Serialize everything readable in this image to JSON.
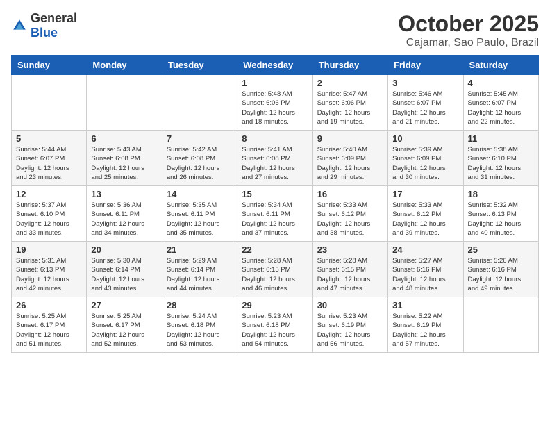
{
  "logo": {
    "general": "General",
    "blue": "Blue"
  },
  "title": "October 2025",
  "location": "Cajamar, Sao Paulo, Brazil",
  "days_header": [
    "Sunday",
    "Monday",
    "Tuesday",
    "Wednesday",
    "Thursday",
    "Friday",
    "Saturday"
  ],
  "weeks": [
    [
      {
        "day": "",
        "info": ""
      },
      {
        "day": "",
        "info": ""
      },
      {
        "day": "",
        "info": ""
      },
      {
        "day": "1",
        "info": "Sunrise: 5:48 AM\nSunset: 6:06 PM\nDaylight: 12 hours\nand 18 minutes."
      },
      {
        "day": "2",
        "info": "Sunrise: 5:47 AM\nSunset: 6:06 PM\nDaylight: 12 hours\nand 19 minutes."
      },
      {
        "day": "3",
        "info": "Sunrise: 5:46 AM\nSunset: 6:07 PM\nDaylight: 12 hours\nand 21 minutes."
      },
      {
        "day": "4",
        "info": "Sunrise: 5:45 AM\nSunset: 6:07 PM\nDaylight: 12 hours\nand 22 minutes."
      }
    ],
    [
      {
        "day": "5",
        "info": "Sunrise: 5:44 AM\nSunset: 6:07 PM\nDaylight: 12 hours\nand 23 minutes."
      },
      {
        "day": "6",
        "info": "Sunrise: 5:43 AM\nSunset: 6:08 PM\nDaylight: 12 hours\nand 25 minutes."
      },
      {
        "day": "7",
        "info": "Sunrise: 5:42 AM\nSunset: 6:08 PM\nDaylight: 12 hours\nand 26 minutes."
      },
      {
        "day": "8",
        "info": "Sunrise: 5:41 AM\nSunset: 6:08 PM\nDaylight: 12 hours\nand 27 minutes."
      },
      {
        "day": "9",
        "info": "Sunrise: 5:40 AM\nSunset: 6:09 PM\nDaylight: 12 hours\nand 29 minutes."
      },
      {
        "day": "10",
        "info": "Sunrise: 5:39 AM\nSunset: 6:09 PM\nDaylight: 12 hours\nand 30 minutes."
      },
      {
        "day": "11",
        "info": "Sunrise: 5:38 AM\nSunset: 6:10 PM\nDaylight: 12 hours\nand 31 minutes."
      }
    ],
    [
      {
        "day": "12",
        "info": "Sunrise: 5:37 AM\nSunset: 6:10 PM\nDaylight: 12 hours\nand 33 minutes."
      },
      {
        "day": "13",
        "info": "Sunrise: 5:36 AM\nSunset: 6:11 PM\nDaylight: 12 hours\nand 34 minutes."
      },
      {
        "day": "14",
        "info": "Sunrise: 5:35 AM\nSunset: 6:11 PM\nDaylight: 12 hours\nand 35 minutes."
      },
      {
        "day": "15",
        "info": "Sunrise: 5:34 AM\nSunset: 6:11 PM\nDaylight: 12 hours\nand 37 minutes."
      },
      {
        "day": "16",
        "info": "Sunrise: 5:33 AM\nSunset: 6:12 PM\nDaylight: 12 hours\nand 38 minutes."
      },
      {
        "day": "17",
        "info": "Sunrise: 5:33 AM\nSunset: 6:12 PM\nDaylight: 12 hours\nand 39 minutes."
      },
      {
        "day": "18",
        "info": "Sunrise: 5:32 AM\nSunset: 6:13 PM\nDaylight: 12 hours\nand 40 minutes."
      }
    ],
    [
      {
        "day": "19",
        "info": "Sunrise: 5:31 AM\nSunset: 6:13 PM\nDaylight: 12 hours\nand 42 minutes."
      },
      {
        "day": "20",
        "info": "Sunrise: 5:30 AM\nSunset: 6:14 PM\nDaylight: 12 hours\nand 43 minutes."
      },
      {
        "day": "21",
        "info": "Sunrise: 5:29 AM\nSunset: 6:14 PM\nDaylight: 12 hours\nand 44 minutes."
      },
      {
        "day": "22",
        "info": "Sunrise: 5:28 AM\nSunset: 6:15 PM\nDaylight: 12 hours\nand 46 minutes."
      },
      {
        "day": "23",
        "info": "Sunrise: 5:28 AM\nSunset: 6:15 PM\nDaylight: 12 hours\nand 47 minutes."
      },
      {
        "day": "24",
        "info": "Sunrise: 5:27 AM\nSunset: 6:16 PM\nDaylight: 12 hours\nand 48 minutes."
      },
      {
        "day": "25",
        "info": "Sunrise: 5:26 AM\nSunset: 6:16 PM\nDaylight: 12 hours\nand 49 minutes."
      }
    ],
    [
      {
        "day": "26",
        "info": "Sunrise: 5:25 AM\nSunset: 6:17 PM\nDaylight: 12 hours\nand 51 minutes."
      },
      {
        "day": "27",
        "info": "Sunrise: 5:25 AM\nSunset: 6:17 PM\nDaylight: 12 hours\nand 52 minutes."
      },
      {
        "day": "28",
        "info": "Sunrise: 5:24 AM\nSunset: 6:18 PM\nDaylight: 12 hours\nand 53 minutes."
      },
      {
        "day": "29",
        "info": "Sunrise: 5:23 AM\nSunset: 6:18 PM\nDaylight: 12 hours\nand 54 minutes."
      },
      {
        "day": "30",
        "info": "Sunrise: 5:23 AM\nSunset: 6:19 PM\nDaylight: 12 hours\nand 56 minutes."
      },
      {
        "day": "31",
        "info": "Sunrise: 5:22 AM\nSunset: 6:19 PM\nDaylight: 12 hours\nand 57 minutes."
      },
      {
        "day": "",
        "info": ""
      }
    ]
  ]
}
